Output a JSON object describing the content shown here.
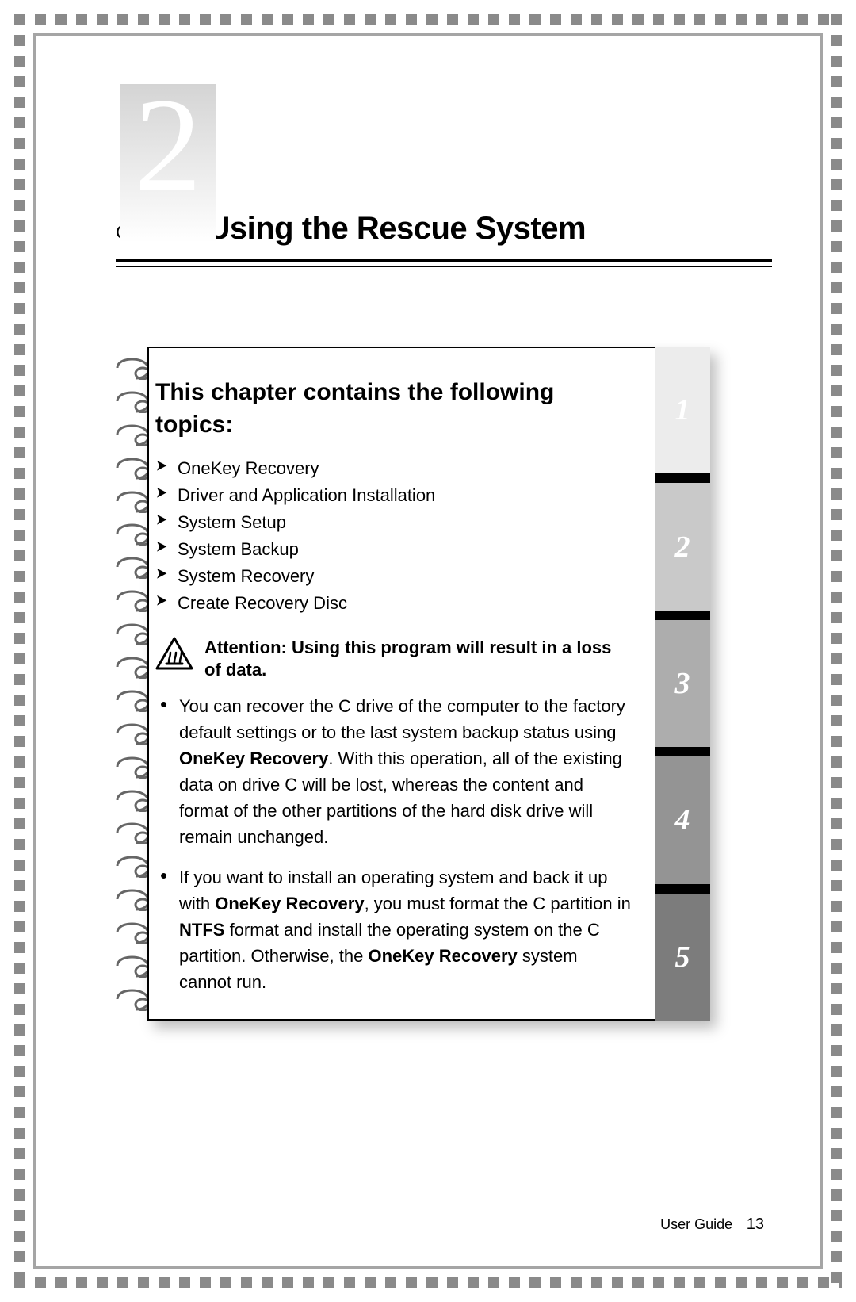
{
  "chapter": {
    "number_large": "2",
    "label": "Chapter",
    "title": "Using the Rescue System"
  },
  "topics_heading": "This chapter contains the following topics:",
  "topics": [
    "OneKey Recovery",
    "Driver and Application Installation",
    "System Setup",
    "System Backup",
    "System Recovery",
    "Create Recovery Disc"
  ],
  "attention": "Attention: Using this program will result in a loss of data.",
  "para1": {
    "a": "You can recover the C drive of the computer to the factory default settings or to the last system backup status using ",
    "b": "OneKey Recovery",
    "c": ". With this operation, all of the existing data on drive C will be lost, whereas the content and format of the other partitions of the hard disk drive will remain unchanged."
  },
  "para2": {
    "a": "If you want to install an operating system and back it up with ",
    "b": "OneKey Recovery",
    "c": ", you must format the C partition in ",
    "d": "NTFS",
    "e": " format and install the operating system on the C partition. Otherwise, the ",
    "f": "OneKey Recovery",
    "g": " system cannot run."
  },
  "tabs": [
    "1",
    "2",
    "3",
    "4",
    "5"
  ],
  "footer": {
    "label": "User Guide",
    "page": "13"
  }
}
